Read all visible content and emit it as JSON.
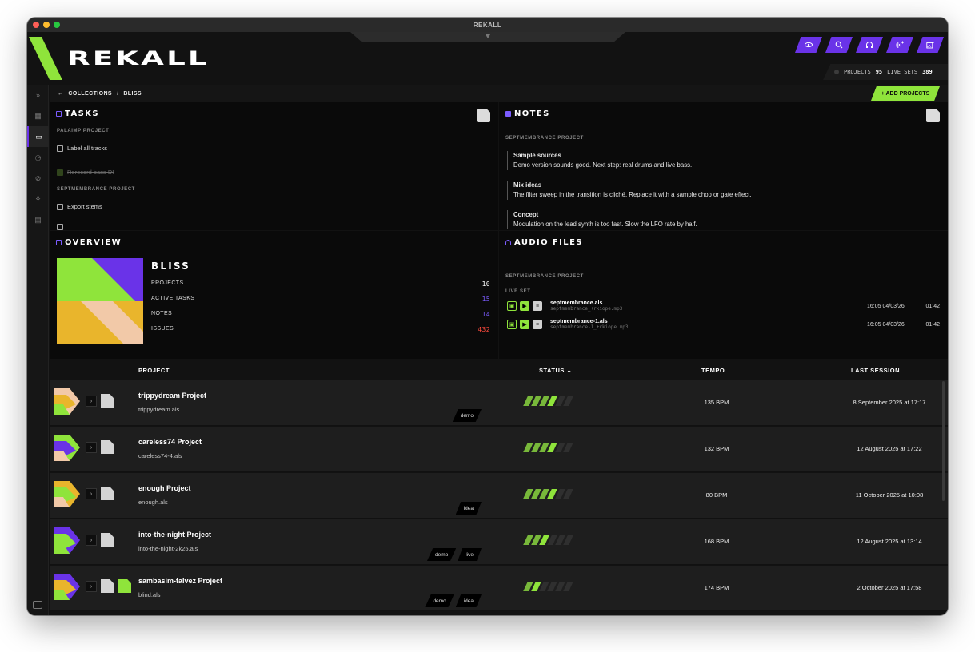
{
  "window": {
    "title": "REKALL"
  },
  "app": {
    "logo": "REKALL"
  },
  "header": {
    "buttons": [
      "eye-icon",
      "search-icon",
      "headphones-icon",
      "waveform-add-icon",
      "image-add-icon"
    ],
    "stats": {
      "projects_label": "PROJECTS",
      "projects_value": "95",
      "livesets_label": "LIVE SETS",
      "livesets_value": "389"
    }
  },
  "breadcrumb": {
    "back": "COLLECTIONS",
    "separator": "/",
    "current": "BLISS"
  },
  "add_projects_label": "+ ADD PROJECTS",
  "tasks": {
    "title": "TASKS",
    "groups": [
      {
        "name": "PALAIMP PROJECT",
        "items": [
          {
            "label": "Label all tracks",
            "done": false
          },
          {
            "label": "Rerecord bass DI",
            "done": true
          }
        ]
      },
      {
        "name": "SEPTMEMBRANCE PROJECT",
        "items": [
          {
            "label": "Export stems",
            "done": false
          }
        ]
      }
    ]
  },
  "notes": {
    "title": "NOTES",
    "group": "SEPTMEMBRANCE PROJECT",
    "items": [
      {
        "title": "Sample sources",
        "body": "Demo version sounds good. Next step: real drums and live bass."
      },
      {
        "title": "Mix ideas",
        "body": "The filter sweep in the transition is cliché. Replace it with a sample chop or gate effect."
      },
      {
        "title": "Concept",
        "body": "Modulation on the lead synth is too fast. Slow the LFO rate by half."
      }
    ]
  },
  "overview": {
    "title": "OVERVIEW",
    "name": "BLISS",
    "stats": [
      {
        "label": "PROJECTS",
        "value": "10",
        "color": "#ffffff"
      },
      {
        "label": "ACTIVE TASKS",
        "value": "15",
        "color": "#7b5cff"
      },
      {
        "label": "NOTES",
        "value": "14",
        "color": "#7b5cff"
      },
      {
        "label": "ISSUES",
        "value": "432",
        "color": "#ff4a3d"
      }
    ]
  },
  "audio_files": {
    "title": "AUDIO FILES",
    "group": "SEPTMEMBRANCE PROJECT",
    "subgroup": "LIVE SET",
    "items": [
      {
        "name": "septmembrance.als",
        "file": "septmembrance_+rkiope.mp3",
        "date": "16:05 04/03/26",
        "duration": "01:42"
      },
      {
        "name": "septmembrance-1.als",
        "file": "septmembrance-1_+rkiope.mp3",
        "date": "16:05 04/03/26",
        "duration": "01:42"
      }
    ]
  },
  "table": {
    "headers": {
      "project": "PROJECT",
      "status": "STATUS",
      "tempo": "TEMPO",
      "last_session": "LAST SESSION"
    },
    "rows": [
      {
        "name": "trippydream Project",
        "file": "trippydream.als",
        "tags": [
          "demo"
        ],
        "status": 4,
        "tempo": "135 BPM",
        "session": "8 September 2025 at 17:17"
      },
      {
        "name": "careless74 Project",
        "file": "careless74-4.als",
        "tags": [],
        "status": 4,
        "tempo": "132 BPM",
        "session": "12 August 2025 at 17:22"
      },
      {
        "name": "enough Project",
        "file": "enough.als",
        "tags": [
          "idea"
        ],
        "status": 4,
        "tempo": "80 BPM",
        "session": "11 October 2025 at 10:08"
      },
      {
        "name": "into-the-night Project",
        "file": "into-the-night-2k25.als",
        "tags": [
          "demo",
          "live"
        ],
        "status": 3,
        "tempo": "168 BPM",
        "session": "12 August 2025 at 13:14"
      },
      {
        "name": "sambasim-talvez Project",
        "file": "blind.als",
        "tags": [
          "demo",
          "idea"
        ],
        "status": 2,
        "tempo": "174 BPM",
        "session": "2 October 2025 at 17:58"
      }
    ]
  },
  "colors": {
    "accent_green": "#8fe43b",
    "accent_purple": "#6a33e8",
    "issues_red": "#ff4a3d"
  }
}
